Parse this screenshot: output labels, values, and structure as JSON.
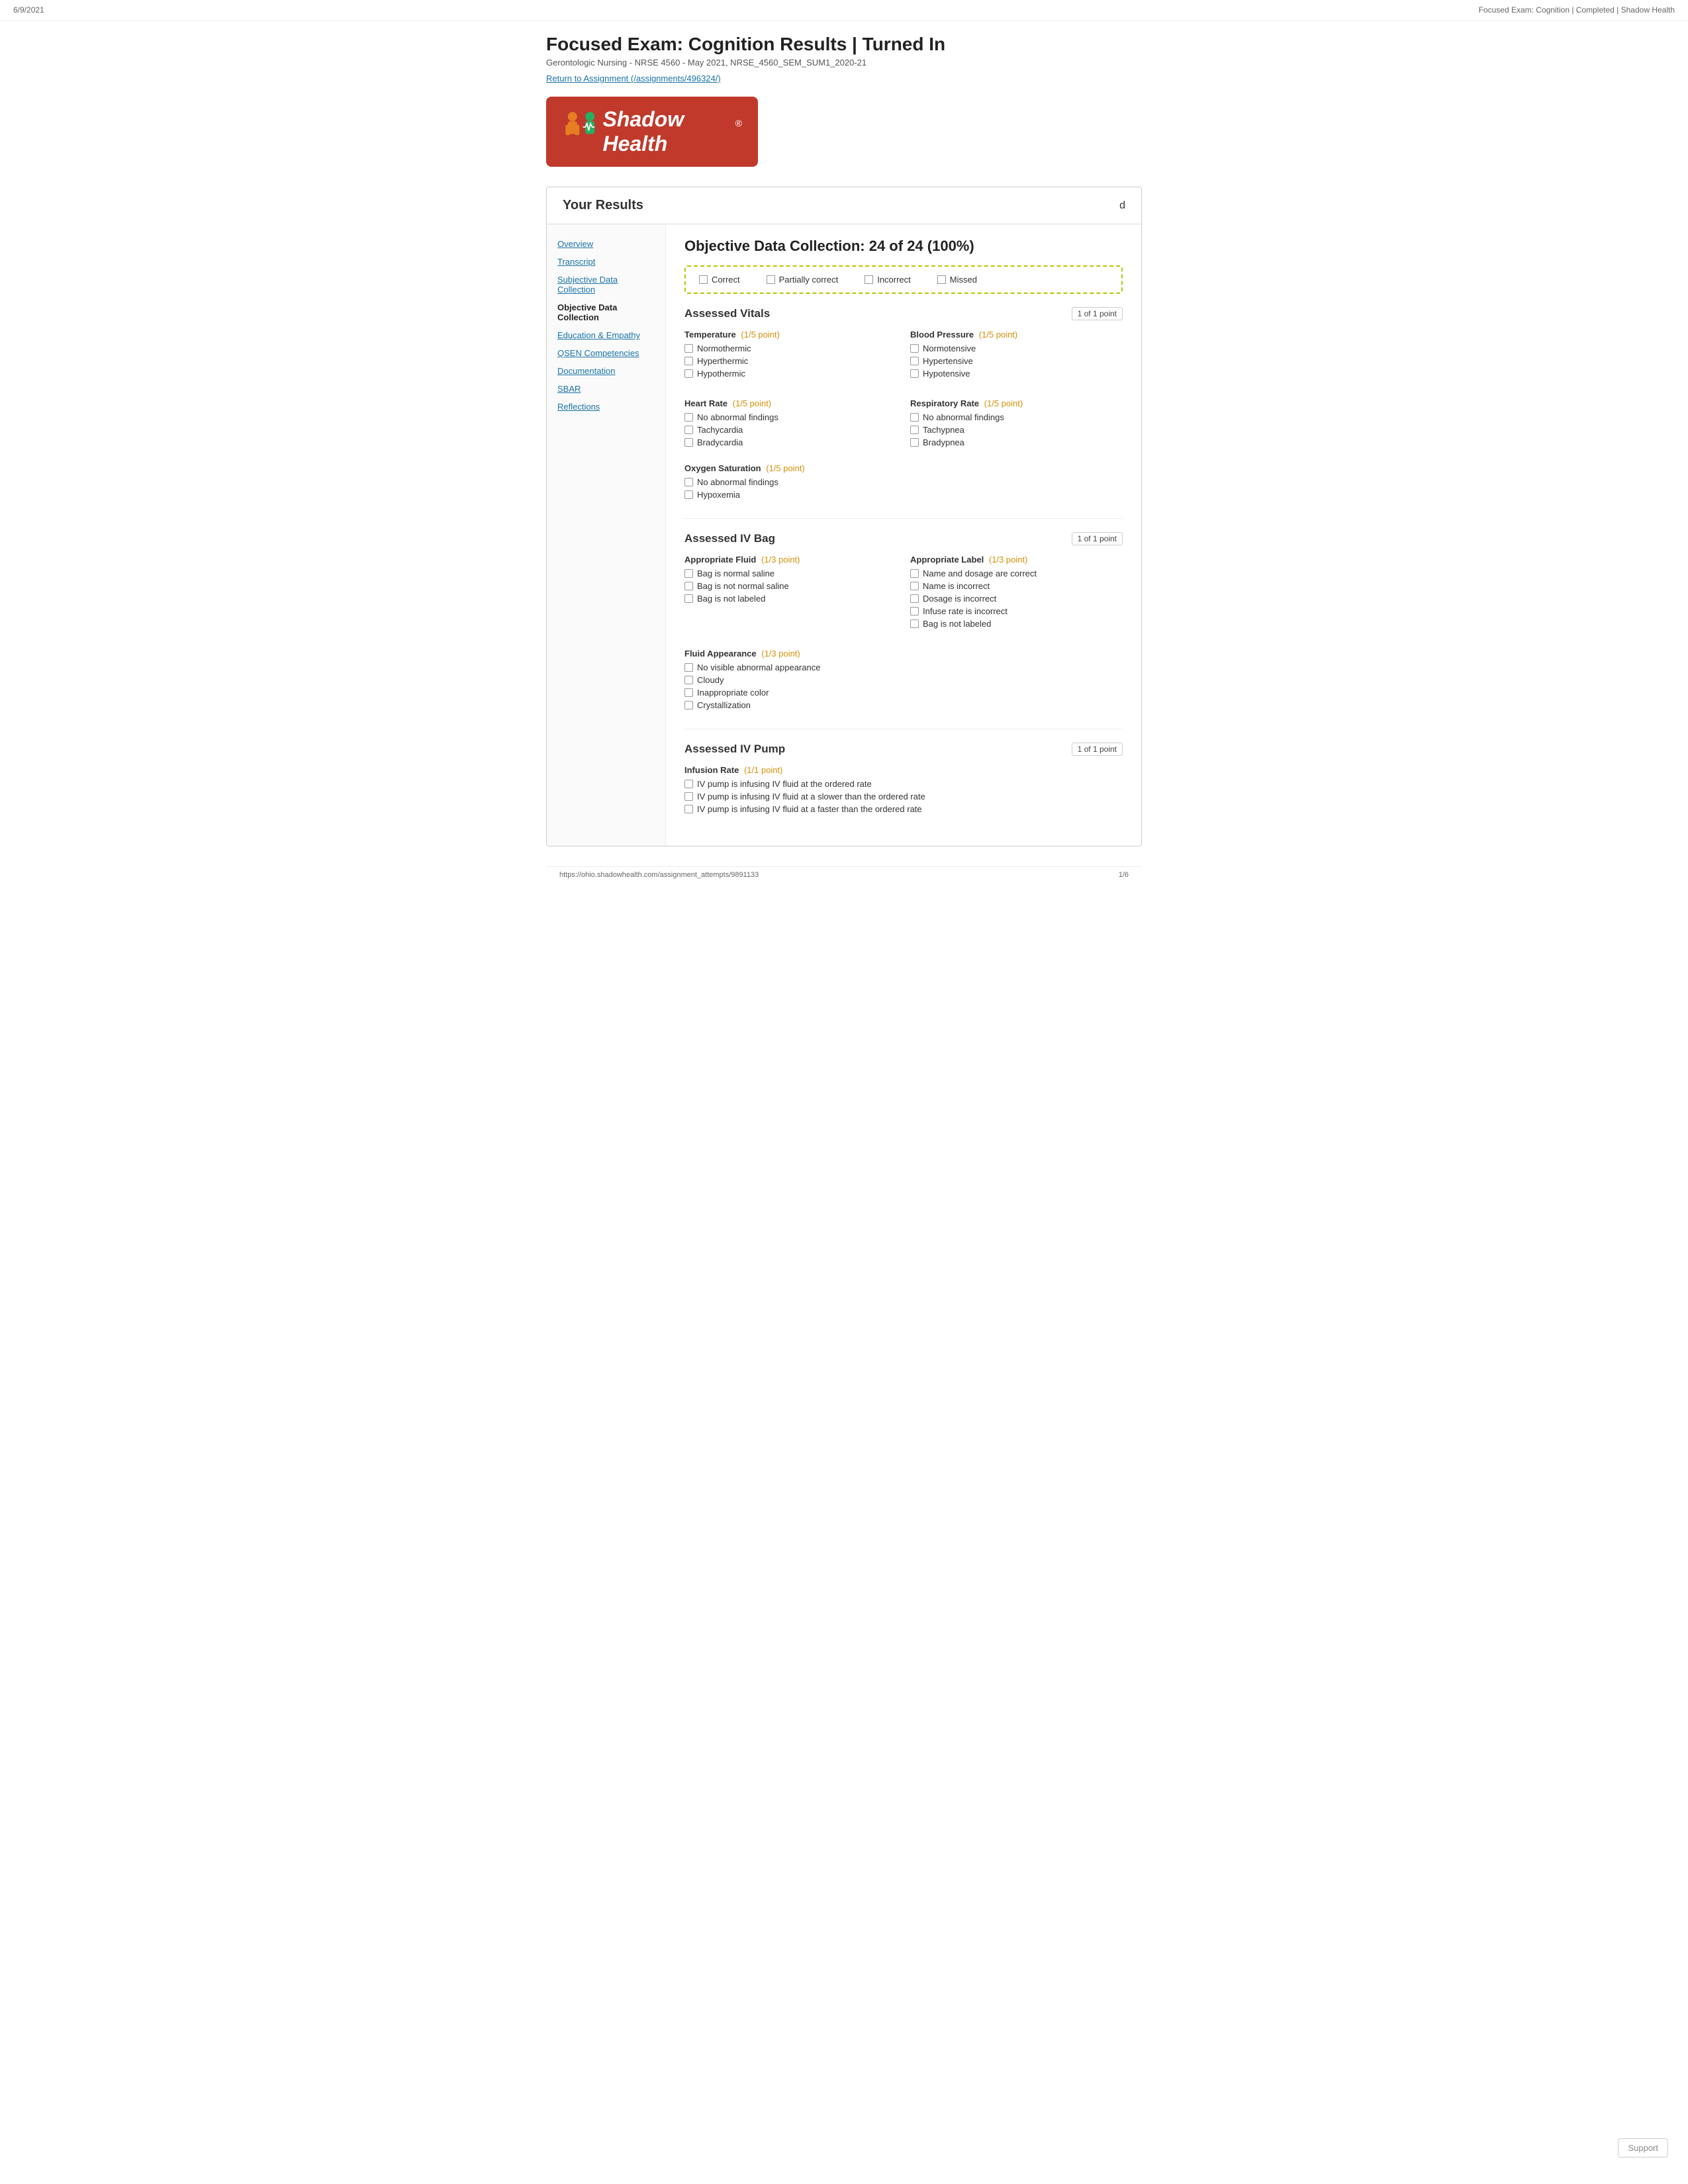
{
  "topbar": {
    "date": "6/9/2021",
    "title": "Focused Exam: Cognition | Completed | Shadow Health"
  },
  "header": {
    "page_title": "Focused Exam: Cognition Results | Turned In",
    "subtitle": "Gerontologic Nursing - NRSE 4560 - May 2021, NRSE_4560_SEM_SUM1_2020-21",
    "return_link": "Return to Assignment (/assignments/496324/)"
  },
  "logo": {
    "text": "Shadow Health",
    "reg": "®"
  },
  "results": {
    "title": "Your Results",
    "toggle_icon": "d"
  },
  "sidebar": {
    "items": [
      {
        "label": "Overview",
        "active": false
      },
      {
        "label": "Transcript",
        "active": false
      },
      {
        "label": "Subjective Data Collection",
        "active": false
      },
      {
        "label": "Objective Data Collection",
        "active": true
      },
      {
        "label": "Education & Empathy",
        "active": false
      },
      {
        "label": "QSEN Competencies",
        "active": false
      },
      {
        "label": "Documentation",
        "active": false
      },
      {
        "label": "SBAR",
        "active": false
      },
      {
        "label": "Reflections",
        "active": false
      }
    ]
  },
  "main": {
    "section_title": "Objective Data Collection: 24 of 24 (100%)",
    "legend": {
      "correct": "Correct",
      "partially_correct": "Partially correct",
      "incorrect": "Incorrect",
      "missed": "Missed"
    },
    "assessed_vitals": {
      "title": "Assessed Vitals",
      "badge": "1 of 1 point",
      "temperature": {
        "label": "Temperature",
        "point": "(1/5 point)",
        "options": [
          "Normothermic",
          "Hyperthermic",
          "Hypothermic"
        ]
      },
      "blood_pressure": {
        "label": "Blood Pressure",
        "point": "(1/5 point)",
        "options": [
          "Normotensive",
          "Hypertensive",
          "Hypotensive"
        ]
      },
      "heart_rate": {
        "label": "Heart Rate",
        "point": "(1/5 point)",
        "options": [
          "No abnormal findings",
          "Tachycardia",
          "Bradycardia"
        ]
      },
      "respiratory_rate": {
        "label": "Respiratory Rate",
        "point": "(1/5 point)",
        "options": [
          "No abnormal findings",
          "Tachypnea",
          "Bradypnea"
        ]
      },
      "oxygen_saturation": {
        "label": "Oxygen Saturation",
        "point": "(1/5 point)",
        "options": [
          "No abnormal findings",
          "Hypoxemia"
        ]
      }
    },
    "assessed_iv_bag": {
      "title": "Assessed IV Bag",
      "badge": "1 of 1 point",
      "appropriate_fluid": {
        "label": "Appropriate Fluid",
        "point": "(1/3 point)",
        "options": [
          "Bag is normal saline",
          "Bag is not normal saline",
          "Bag is not labeled"
        ]
      },
      "appropriate_label": {
        "label": "Appropriate Label",
        "point": "(1/3 point)",
        "options": [
          "Name and dosage are correct",
          "Name is incorrect",
          "Dosage is incorrect",
          "Infuse rate is incorrect",
          "Bag is not labeled"
        ]
      },
      "fluid_appearance": {
        "label": "Fluid Appearance",
        "point": "(1/3 point)",
        "options": [
          "No visible abnormal appearance",
          "Cloudy",
          "Inappropriate color",
          "Crystallization"
        ]
      }
    },
    "assessed_iv_pump": {
      "title": "Assessed IV Pump",
      "badge": "1 of 1 point",
      "infusion_rate": {
        "label": "Infusion Rate",
        "point": "(1/1 point)",
        "options": [
          "IV pump is infusing IV fluid at the ordered rate",
          "IV pump is infusing IV fluid at a slower than the ordered rate",
          "IV pump is infusing IV fluid at a faster than the ordered rate"
        ]
      }
    }
  },
  "footer": {
    "url": "https://ohio.shadowhealth.com/assignment_attempts/9891133",
    "page": "1/6"
  },
  "support": "Support"
}
